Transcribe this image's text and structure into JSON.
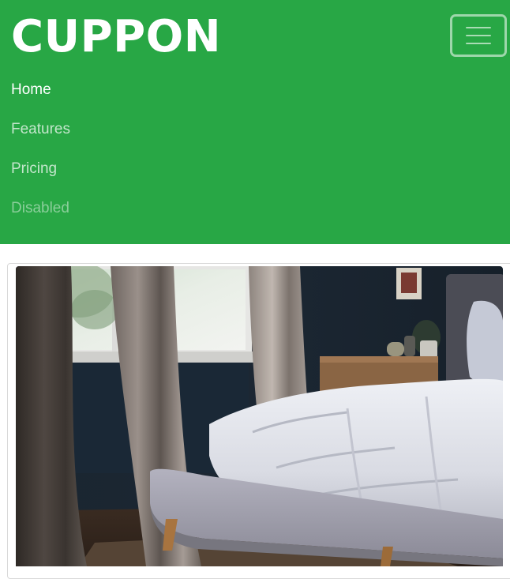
{
  "navbar": {
    "brand": "CUPPON",
    "background_color": "#28a745",
    "toggler_icon": "hamburger-icon",
    "items": [
      {
        "label": "Home",
        "state": "active"
      },
      {
        "label": "Features",
        "state": "normal"
      },
      {
        "label": "Pricing",
        "state": "normal"
      },
      {
        "label": "Disabled",
        "state": "disabled"
      }
    ]
  },
  "card": {
    "image": "bedroom-photo"
  }
}
